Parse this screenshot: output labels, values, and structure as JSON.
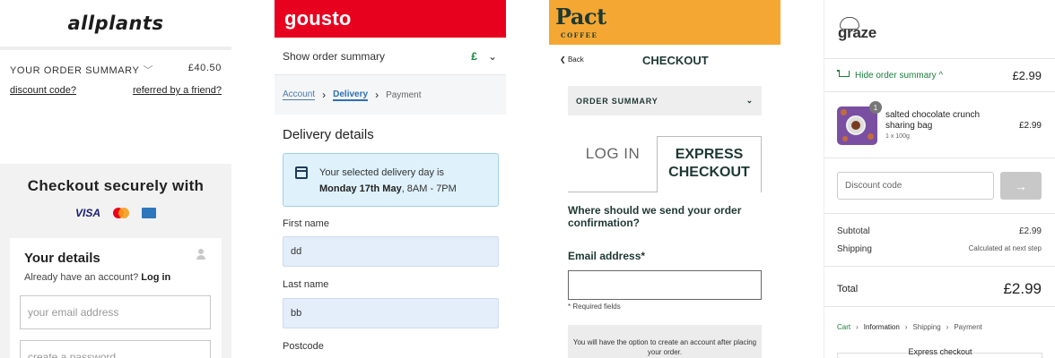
{
  "allplants": {
    "logo": "allplants",
    "order_summary_label": "YOUR ORDER SUMMARY",
    "order_total": "£40.50",
    "discount_link": "discount code?",
    "referral_link": "referred by a friend?",
    "secure_heading": "Checkout securely with",
    "card_brands": [
      "VISA",
      "mastercard-icon",
      "amex-icon"
    ],
    "details_title": "Your details",
    "account_prompt": "Already have an account?",
    "login_link": "Log in",
    "email_placeholder": "your email address",
    "password_placeholder": "create a password"
  },
  "gousto": {
    "logo": "gousto",
    "brand_color": "#e8011e",
    "show_summary": "Show order summary",
    "currency": "£",
    "breadcrumb": {
      "account": "Account",
      "delivery": "Delivery",
      "payment": "Payment"
    },
    "delivery_heading": "Delivery details",
    "notice_prefix": "Your selected delivery day is",
    "notice_day": "Monday 17th May",
    "notice_time": ", 8AM - 7PM",
    "first_name_label": "First name",
    "first_name_value": "dd",
    "last_name_label": "Last name",
    "last_name_value": "bb",
    "postcode_label": "Postcode"
  },
  "pact": {
    "logo": "Pact",
    "logo_sub": "COFFEE",
    "brand_color": "#f4a833",
    "back": "Back",
    "checkout_title": "CHECKOUT",
    "order_summary": "ORDER SUMMARY",
    "tab_login": "LOG IN",
    "tab_express": "EXPRESS CHECKOUT",
    "question": "Where should we send your order confirmation?",
    "email_label": "Email address*",
    "required_note": "* Required fields",
    "info_text": "You will have the option to create an account after placing your order."
  },
  "graze": {
    "logo": "graze",
    "hide_summary": "Hide order summary ^",
    "summary_total": "£2.99",
    "product": {
      "quantity_badge": "1",
      "name": "salted chocolate crunch sharing bag",
      "size": "1 x 100g",
      "price": "£2.99"
    },
    "discount_placeholder": "Discount code",
    "apply_arrow": "→",
    "subtotal_label": "Subtotal",
    "subtotal_value": "£2.99",
    "shipping_label": "Shipping",
    "shipping_value": "Calculated at next step",
    "total_label": "Total",
    "total_value": "£2.99",
    "steps": [
      "Cart",
      "Information",
      "Shipping",
      "Payment"
    ],
    "express_checkout": "Express checkout"
  }
}
